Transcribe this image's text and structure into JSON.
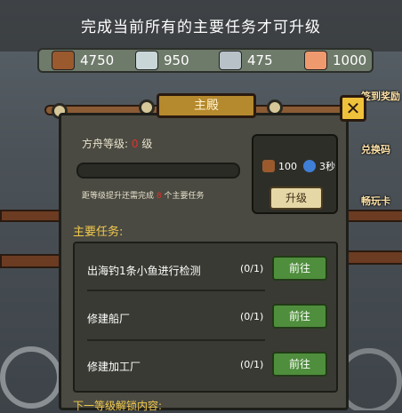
{
  "top_notice": "完成当前所有的主要任务才可升级",
  "resources": [
    {
      "icon": "wood-log-icon",
      "value": "4750"
    },
    {
      "icon": "water-bucket-icon",
      "value": "950"
    },
    {
      "icon": "metal-ingot-icon",
      "value": "475"
    },
    {
      "icon": "fish-steak-icon",
      "value": "1000"
    }
  ],
  "side_menu": {
    "sign_reward": "签到奖励",
    "redeem_code": "兑换码",
    "play_card": "畅玩卡"
  },
  "panel": {
    "title": "主殿",
    "ark_level_label": "方舟等级:",
    "ark_level_value": "0",
    "ark_level_unit": "级",
    "progress_fraction": 0,
    "requirement_prefix": "距等级提升还需完成",
    "requirement_num": "8",
    "requirement_suffix": "个主要任务",
    "upgrade": {
      "wood_cost": "100",
      "time_cost": "3秒",
      "button_label": "升级"
    },
    "main_tasks_header": "主要任务:",
    "tasks": [
      {
        "name": "出海钓1条小鱼进行检测",
        "count": "(0/1)",
        "button": "前往"
      },
      {
        "name": "修建船厂",
        "count": "(0/1)",
        "button": "前往"
      },
      {
        "name": "修建加工厂",
        "count": "(0/1)",
        "button": "前往"
      }
    ],
    "next_unlock": "下一等级解锁内容:"
  },
  "colors": {
    "accent_red": "#e0322a",
    "header_yellow": "#f2c94c",
    "go_button_green": "#4e8e3c"
  }
}
